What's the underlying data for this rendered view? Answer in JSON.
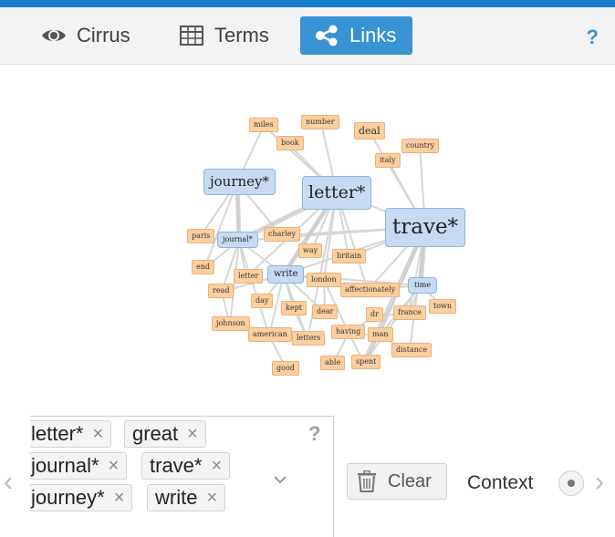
{
  "tabs": [
    {
      "label": "Cirrus",
      "icon": "eye-icon",
      "active": false
    },
    {
      "label": "Terms",
      "icon": "table-icon",
      "active": false
    },
    {
      "label": "Links",
      "icon": "share-icon",
      "active": true
    }
  ],
  "help_label": "?",
  "colors": {
    "accent": "#157fcc",
    "active_tab": "#3892d3",
    "term_node": "#fdcf9f",
    "keyword_node": "#c6dbf3"
  },
  "graph": {
    "keyword_nodes": [
      "journey*",
      "letter*",
      "trave*",
      "journal*",
      "write",
      "time"
    ],
    "term_nodes": [
      "miles",
      "number",
      "deal",
      "book",
      "country",
      "italy",
      "paris",
      "charley",
      "end",
      "way",
      "britain",
      "letter",
      "read",
      "london",
      "affectionately",
      "day",
      "kept",
      "dear",
      "dr",
      "france",
      "town",
      "johnson",
      "american",
      "letters",
      "having",
      "man",
      "distance",
      "good",
      "able",
      "spent"
    ]
  },
  "keywords": {
    "chips": [
      "letter*",
      "great",
      "journal*",
      "trave*",
      "journey*",
      "write"
    ],
    "remove_icon": "×",
    "help_label": "?",
    "dropdown_icon": "chevron-down-icon"
  },
  "controls": {
    "clear_label": "Clear",
    "context_label": "Context",
    "nav_prev": "‹",
    "nav_next": "›"
  }
}
